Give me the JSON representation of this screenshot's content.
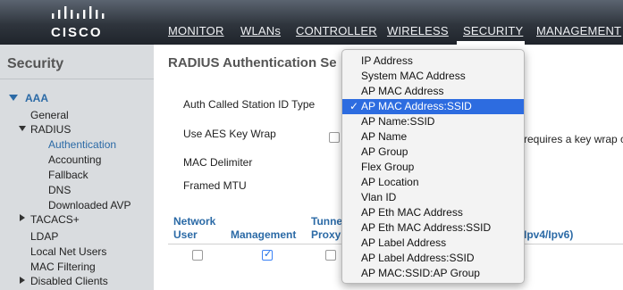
{
  "brand": {
    "logo_text": "CISCO"
  },
  "nav": {
    "monitor": "MONITOR",
    "wlans": "WLANs",
    "controller": "CONTROLLER",
    "wireless": "WIRELESS",
    "security": "SECURITY",
    "management": "MANAGEMENT"
  },
  "sidebar": {
    "title": "Security",
    "aaa": "AAA",
    "general": "General",
    "radius": "RADIUS",
    "authentication": "Authentication",
    "accounting": "Accounting",
    "fallback": "Fallback",
    "dns": "DNS",
    "downloaded_avp": "Downloaded AVP",
    "tacacs": "TACACS+",
    "ldap": "LDAP",
    "local_net_users": "Local Net Users",
    "mac_filtering": "MAC Filtering",
    "disabled_clients": "Disabled Clients"
  },
  "main": {
    "title": "RADIUS Authentication Se",
    "auth_called_station_id_type": "Auth Called Station ID Type",
    "use_aes_key_wrap": "Use AES Key Wrap",
    "aes_note_partial": "requires a key wrap c",
    "mac_delimiter": "MAC Delimiter",
    "framed_mtu": "Framed MTU"
  },
  "table": {
    "headers": {
      "network_user_1": "Network",
      "network_user_2": "User",
      "management": "Management",
      "tunnel_proxy_1": "Tunne",
      "tunnel_proxy_2": "Proxy",
      "ipv4_ipv6": "Ipv4/Ipv6)"
    },
    "row": {
      "network_user": false,
      "management": true,
      "tunnel_proxy": false
    }
  },
  "dropdown": {
    "selected": "AP MAC Address:SSID",
    "options": [
      "IP Address",
      "System MAC Address",
      "AP MAC Address",
      "AP MAC Address:SSID",
      "AP Name:SSID",
      "AP Name",
      "AP Group",
      "Flex Group",
      "AP Location",
      "Vlan ID",
      "AP Eth MAC Address",
      "AP Eth MAC Address:SSID",
      "AP Label Address",
      "AP Label Address:SSID",
      "AP MAC:SSID:AP Group"
    ],
    "check_glyph": "✓"
  }
}
